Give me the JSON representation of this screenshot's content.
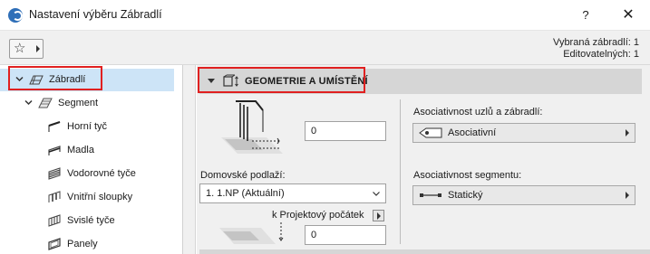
{
  "window": {
    "title": "Nastavení výběru Zábradlí",
    "help_label": "?",
    "close_label": "✕"
  },
  "toolbar": {
    "favorites_icon": "star-icon",
    "selected_label": "Vybraná zábradlí: 1",
    "editable_label": "Editovatelných: 1"
  },
  "tree": {
    "items": [
      {
        "label": "Zábradlí",
        "icon": "railing-icon",
        "level": 0,
        "expanded": true,
        "selected": true
      },
      {
        "label": "Segment",
        "icon": "segment-icon",
        "level": 1,
        "expanded": true,
        "selected": false
      },
      {
        "label": "Horní tyč",
        "icon": "toprail-icon",
        "level": 2,
        "selected": false
      },
      {
        "label": "Madla",
        "icon": "handrail-icon",
        "level": 2,
        "selected": false
      },
      {
        "label": "Vodorovné tyče",
        "icon": "horizontal-rails-icon",
        "level": 2,
        "selected": false
      },
      {
        "label": "Vnitřní sloupky",
        "icon": "inner-posts-icon",
        "level": 2,
        "selected": false
      },
      {
        "label": "Svislé tyče",
        "icon": "vertical-rails-icon",
        "level": 2,
        "selected": false
      },
      {
        "label": "Panely",
        "icon": "panels-icon",
        "level": 2,
        "selected": false
      }
    ]
  },
  "section": {
    "title": "GEOMETRIE A UMÍSTĚNÍ",
    "icon": "geometry-icon"
  },
  "geometry": {
    "height_value": "0",
    "home_story_label": "Domovské podlaží:",
    "home_story_value": "1. 1.NP (Aktuální)",
    "reference_label": "k Projektový počátek",
    "offset_value": "0",
    "node_assoc_label": "Asociativnost uzlů a zábradlí:",
    "node_assoc_value": "Asociativní",
    "segment_assoc_label": "Asociativnost segmentu:",
    "segment_assoc_value": "Statický"
  },
  "colors": {
    "highlight": "#e02020",
    "selection": "#cde4f7",
    "panel_bg": "#f0f0f0",
    "header_bg": "#d6d6d6"
  }
}
